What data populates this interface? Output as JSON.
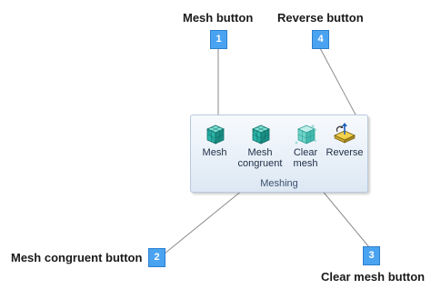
{
  "callouts": [
    {
      "number": "1",
      "label": "Mesh button"
    },
    {
      "number": "4",
      "label": "Reverse button"
    },
    {
      "number": "2",
      "label": "Mesh congruent button"
    },
    {
      "number": "3",
      "label": "Clear mesh button"
    }
  ],
  "ribbon": {
    "group_label": "Meshing",
    "buttons": [
      {
        "label_line1": "Mesh",
        "label_line2": "",
        "icon": "mesh-icon"
      },
      {
        "label_line1": "Mesh",
        "label_line2": "congruent",
        "icon": "mesh-congruent-icon"
      },
      {
        "label_line1": "Clear",
        "label_line2": "mesh",
        "icon": "clear-mesh-icon"
      },
      {
        "label_line1": "Reverse",
        "label_line2": "",
        "icon": "reverse-icon"
      }
    ]
  },
  "colors": {
    "badge": "#4aa3f0",
    "ribbon_bg": "#dde8f4",
    "mesh_icon": "#2bb3a8"
  }
}
